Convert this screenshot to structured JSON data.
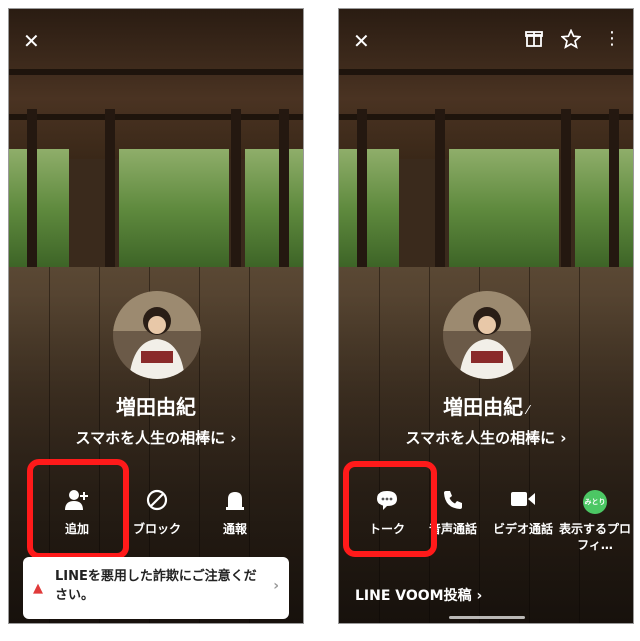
{
  "left_screen": {
    "profile": {
      "name": "増田由紀",
      "status_message": "スマホを人生の相棒に"
    },
    "actions": [
      {
        "label": "追加",
        "icon": "add-friend-icon"
      },
      {
        "label": "ブロック",
        "icon": "block-icon"
      },
      {
        "label": "通報",
        "icon": "report-icon"
      }
    ],
    "notice": {
      "text": "LINEを悪用した詐欺にご注意ください。"
    },
    "top_icons": [
      "close-icon"
    ]
  },
  "right_screen": {
    "profile": {
      "name": "増田由紀",
      "status_message": "スマホを人生の相棒に"
    },
    "actions": [
      {
        "label": "トーク",
        "icon": "chat-icon"
      },
      {
        "label": "音声通話",
        "icon": "phone-icon"
      },
      {
        "label": "ビデオ通話",
        "icon": "video-icon"
      },
      {
        "label": "表示するプロフィ…",
        "icon": "mitori-icon",
        "badge": "みとり"
      }
    ],
    "voom": {
      "label": "LINE VOOM投稿"
    },
    "top_icons": [
      "close-icon",
      "gift-icon",
      "star-icon",
      "more-icon"
    ]
  },
  "colors": {
    "highlight": "#ff1a1a",
    "line_green": "#4cc764",
    "warning_red": "#e03a3a"
  }
}
